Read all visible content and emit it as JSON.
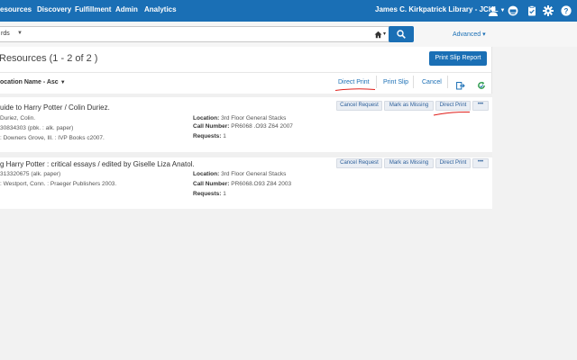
{
  "nav": {
    "items": [
      "esources",
      "Discovery",
      "Fulfillment",
      "Admin",
      "Analytics"
    ],
    "user": "James C. Kirkpatrick Library - JCKL"
  },
  "search": {
    "scope": "rds",
    "advanced": "Advanced ▾"
  },
  "page": {
    "title": "Resources (1 - 2 of 2 )",
    "print_slip_report": "Print Slip Report"
  },
  "toolbar": {
    "sort_label": "ocation Name - Asc",
    "direct_print": "Direct Print",
    "print_slip": "Print Slip",
    "cancel": "Cancel"
  },
  "row_labels": {
    "location": "Location:",
    "call_number": "Call Number:",
    "requests": "Requests:"
  },
  "row_buttons": {
    "cancel_request": "Cancel Request",
    "mark_as_missing": "Mark as Missing",
    "direct_print": "Direct Print",
    "more": "•••"
  },
  "rows": [
    {
      "title": "uide to Harry Potter / Colin Duriez.",
      "line1": "Duriez, Colin.",
      "line2": "30834303 (pbk. : alk. paper)",
      "line3": ": Downers Grove, Ill. : IVP Books c2007.",
      "location": "3rd Floor General Stacks",
      "call_number": "PR6068 .O93 Z64 2007",
      "requests": "1"
    },
    {
      "title": "g Harry Potter : critical essays / edited by Giselle Liza Anatol.",
      "line1": "313320675 (alk. paper)",
      "line2": ": Westport, Conn. : Praeger Publishers 2003.",
      "location": "3rd Floor General Stacks",
      "call_number": "PR6068.O93 Z84 2003",
      "requests": "1"
    }
  ],
  "colors": {
    "brand": "#1a6fb5",
    "annotation": "#e0201c"
  }
}
